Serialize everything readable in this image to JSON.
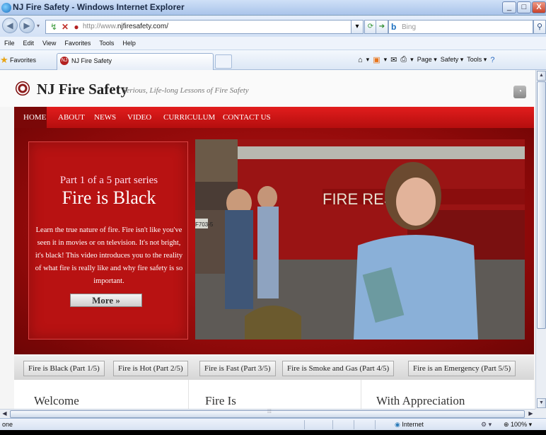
{
  "window": {
    "title": "NJ Fire Safety - Windows Internet Explorer",
    "controls": [
      "_",
      "□",
      "X"
    ]
  },
  "addressbar": {
    "url_prefix": "http://www.",
    "url_domain": "njfiresafety.com/",
    "search_placeholder": "Bing"
  },
  "menu": [
    "File",
    "Edit",
    "View",
    "Favorites",
    "Tools",
    "Help"
  ],
  "favorites": {
    "label": "Favorites",
    "tab_title": "NJ Fire Safety"
  },
  "commandbar": {
    "page": "Page ▾",
    "safety": "Safety ▾",
    "tools": "Tools ▾"
  },
  "site": {
    "name": "NJ Fire Safety",
    "tagline": "Serious, Life-long Lessons of Fire Safety",
    "nav": [
      "HOME",
      "ABOUT",
      "NEWS",
      "VIDEO",
      "CURRICULUM",
      "CONTACT US"
    ],
    "hero": {
      "series": "Part 1 of a 5 part series",
      "title": "Fire is Black",
      "description": "Learn the true nature of fire. Fire isn't like you've seen it in movies or on television. It's not bright, it's black! This video introduces you to the reality of what fire is really like and why fire safety is so important.",
      "more_label": "More »",
      "video_text": "FIRE RESC",
      "video_text_2": "F703-5"
    },
    "series_tabs": [
      "Fire is Black (Part 1/5)",
      "Fire is Hot (Part 2/5)",
      "Fire is Fast (Part 3/5)",
      "Fire is Smoke and Gas (Part 4/5)",
      "Fire is an Emergency (Part 5/5)"
    ],
    "columns": [
      "Welcome",
      "Fire Is",
      "With Appreciation"
    ]
  },
  "status": {
    "text": "one",
    "zone": "Internet",
    "zoom": "100%"
  },
  "colors": {
    "nav_red": "#d41717",
    "hero_red": "#b81212",
    "nav_home": "#7a0808"
  }
}
